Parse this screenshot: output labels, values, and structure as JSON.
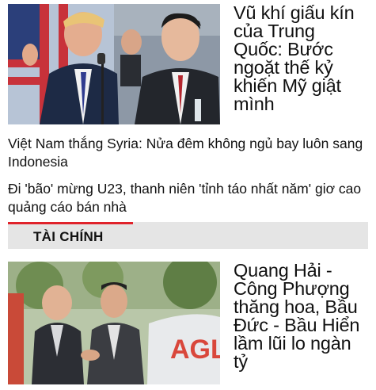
{
  "top_story": {
    "title": "Vũ khí giấu kín của Trung Quốc: Bước ngoặt thế kỷ khiến Mỹ giật mình"
  },
  "headlines": [
    "Việt Nam thắng Syria: Nửa đêm không ngủ bay luôn sang Indonesia",
    "Đi 'bão' mừng U23, thanh niên 'tỉnh táo nhất năm' giơ cao quảng cáo bán nhà"
  ],
  "section": {
    "label": "TÀI CHÍNH",
    "accent_color": "#e0232b"
  },
  "second_story": {
    "title": "Quang Hải - Công Phượng thăng hoa, Bầu Đức - Bầu Hiển lầm lũi lo ngàn tỷ"
  }
}
